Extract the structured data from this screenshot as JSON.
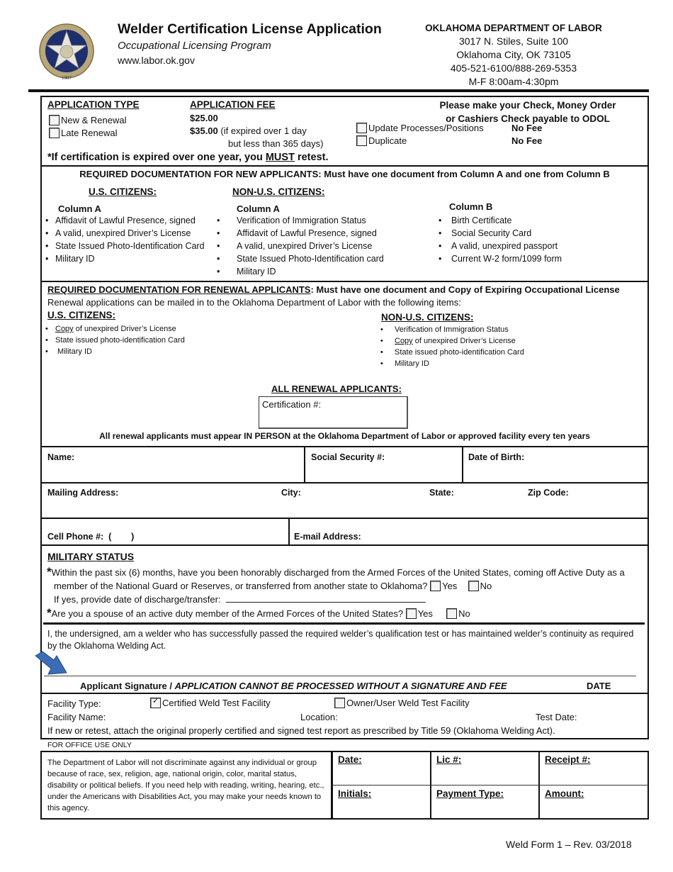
{
  "header": {
    "title": "Welder Certification License Application",
    "subtitle": "Occupational Licensing Program",
    "website": "www.labor.ok.gov",
    "seal_year": "1907",
    "seal_text": "GREAT SEAL OF THE STATE OF OKLAHOMA",
    "agency": {
      "name": "OKLAHOMA DEPARTMENT OF LABOR",
      "address1": "3017 N. Stiles, Suite 100",
      "address2": "Oklahoma City, OK 73105",
      "phone": "405-521-6100/888-269-5353",
      "hours": "M-F 8:00am-4:30pm"
    }
  },
  "application": {
    "type_heading": "APPLICATION TYPE",
    "fee_heading": "APPLICATION FEE",
    "options": [
      {
        "label": "New & Renewal",
        "checked": false
      },
      {
        "label": "Late Renewal",
        "checked": false
      }
    ],
    "fee1": "$25.00",
    "fee2": "$35.00",
    "fee2_note1": "(if expired over 1 day",
    "fee2_note2": "but less than 365 days)",
    "payment_line1": "Please make your Check, Money Order",
    "payment_line2": "or Cashiers Check payable to ODOL",
    "extra_options": [
      {
        "label": "Update Processes/Positions",
        "fee": "No Fee",
        "checked": false
      },
      {
        "label": "Duplicate",
        "fee": "No Fee",
        "checked": false
      }
    ],
    "retest_pre": "*If certification is expired over one year, you ",
    "retest_must": "MUST",
    "retest_post": " retest."
  },
  "new_docs": {
    "heading": "REQUIRED DOCUMENTATION FOR NEW APPLICANTS: Must have one document from Column A and one from Column B",
    "us_heading": "U.S. CITIZENS:",
    "nonus_heading": "NON-U.S. CITIZENS:",
    "us_col_title": "Column A",
    "us_items": [
      "Affidavit of Lawful Presence, signed",
      "A valid, unexpired Driver’s License",
      "State Issued Photo-Identification Card",
      "Military ID"
    ],
    "nonus_col_title": "Column A",
    "nonus_items": [
      "Verification of Immigration Status",
      "Affidavit of Lawful Presence, signed",
      "A valid, unexpired Driver’s License",
      "State Issued Photo-Identification card",
      "Military ID"
    ],
    "colb_title": "Column B",
    "colb_items": [
      "Birth Certificate",
      "Social Security Card",
      "A valid, unexpired passport",
      "Current W-2 form/1099 form"
    ]
  },
  "renewal_docs": {
    "heading_u": "REQUIRED DOCUMENTATION FOR RENEWAL APPLICANTS",
    "heading_rest": ": Must have one document and Copy of Expiring Occupational License",
    "mail_note": "Renewal applications can be mailed in to the Oklahoma Department of Labor with the following items:",
    "us_heading": "U.S. CITIZENS:",
    "us_items": [
      {
        "u": "Copy",
        "rest": " of unexpired Driver’s License"
      },
      {
        "u": "",
        "rest": "State issued photo-identification Card"
      },
      {
        "u": "",
        "rest": " Military ID"
      }
    ],
    "nonus_heading": "NON-U.S. CITIZENS:",
    "nonus_items": [
      {
        "u": "",
        "rest": "Verification of Immigration Status"
      },
      {
        "u": "Copy",
        "rest": " of unexpired Driver’s License"
      },
      {
        "u": "",
        "rest": "State issued photo-identification Card"
      },
      {
        "u": "",
        "rest": "Military ID"
      }
    ],
    "all_heading": "ALL RENEWAL APPLICANTS:",
    "cert_label": "Certification #:",
    "cert_value": "",
    "in_person_note": "All renewal applicants must appear IN PERSON at the Oklahoma Department of Labor or approved facility every ten years"
  },
  "personal": {
    "name_label": "Name:",
    "ssn_label": "Social Security #:",
    "dob_label": "Date of Birth:",
    "address_label": "Mailing Address:",
    "city_label": "City:",
    "state_label": "State:",
    "zip_label": "Zip Code:",
    "phone_label": "Cell Phone #:  (        )",
    "email_label": "E-mail Address:"
  },
  "military": {
    "heading": "MILITARY STATUS",
    "q1_line1": "Within the past six (6) months, have you been honorably discharged from the Armed Forces of the United States, coming off Active Duty as a",
    "q1_line2": "member of the National Guard or Reserves, or transferred from another state to Oklahoma?",
    "q1_date": "If yes, provide date of discharge/transfer:",
    "q2": "Are you a spouse of an active duty member of the Armed Forces of the United States?",
    "yes": "Yes",
    "no": "No"
  },
  "attestation": {
    "text": "I, the undersigned, am a welder who has successfully passed the required welder’s qualification test or has maintained welder’s continuity as required by the Oklahoma Welding Act.",
    "sig_label": "Applicant Signature / ",
    "sig_warning": "APPLICATION CANNOT BE PROCESSED WITHOUT A SIGNATURE AND FEE",
    "date_label": "DATE",
    "arrow_color": "#3a6db5"
  },
  "facility": {
    "type_label": "Facility Type:",
    "certified_label": "Certified Weld Test Facility",
    "certified_checked": true,
    "owner_label": "Owner/User Weld Test Facility",
    "owner_checked": false,
    "name_label": "Facility Name:",
    "location_label": "Location:",
    "test_date_label": "Test Date:",
    "retest_note": "If new or retest, attach the original properly certified and signed test report as prescribed by Title 59 (Oklahoma Welding Act)."
  },
  "office": {
    "label": "FOR OFFICE USE ONLY",
    "disclaimer": "The Department of Labor will not discriminate against any individual or group because of race, sex, religion, age, national origin, color, marital status, disability or political beliefs.  If you need help with reading, writing, hearing, etc., under the Americans with Disabilities Act, you may make your needs known to this agency.",
    "fields": [
      "Date:",
      "Lic #:",
      "Receipt #:",
      "Initials:",
      "Payment Type:",
      "Amount:"
    ]
  },
  "footer": {
    "form_id": "Weld Form 1 – Rev. 03/2018"
  }
}
